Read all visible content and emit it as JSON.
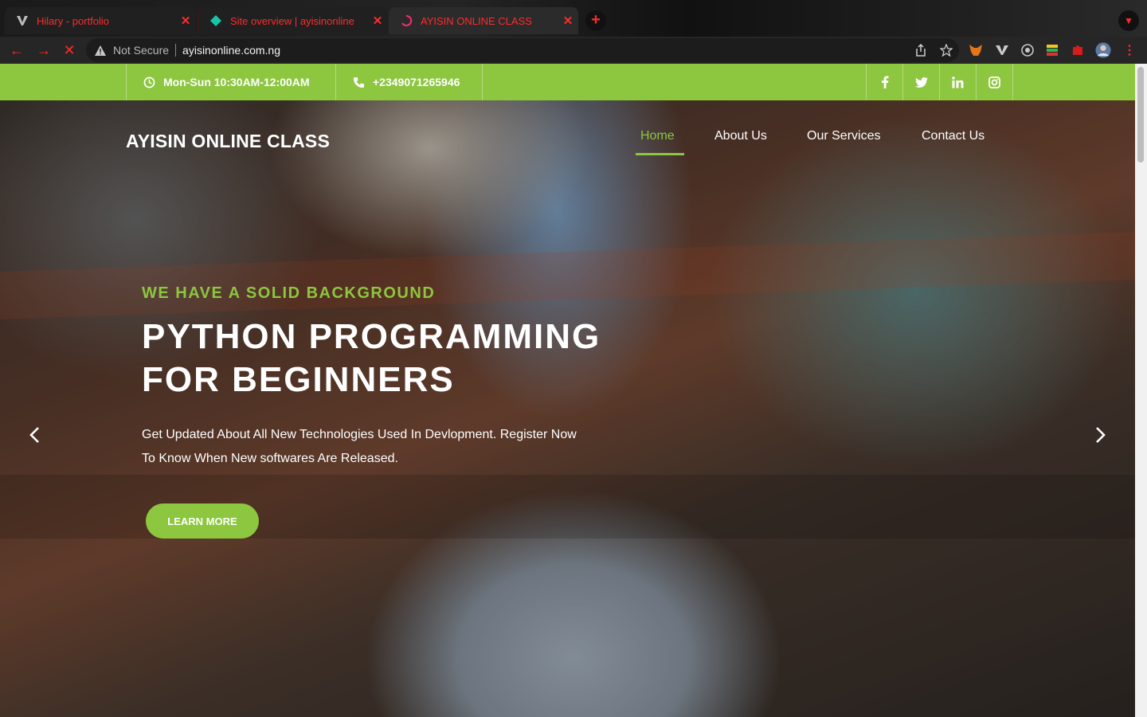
{
  "browser": {
    "tabs": [
      {
        "title": "Hilary - portfolio",
        "favicon": "v-logo-icon"
      },
      {
        "title": "Site overview | ayisinonline",
        "favicon": "diamond-icon"
      },
      {
        "title": "AYISIN ONLINE CLASS",
        "favicon": "loading-spinner-icon"
      }
    ],
    "security_label": "Not Secure",
    "url": "ayisinonline.com.ng",
    "accent": "#ff2b2b"
  },
  "topbar": {
    "hours": "Mon-Sun 10:30AM-12:00AM",
    "phone": "+2349071265946",
    "social": [
      "f",
      "twitter",
      "in",
      "instagram"
    ],
    "color": "#8dc63f"
  },
  "header": {
    "brand": "AYISIN ONLINE CLASS",
    "nav": [
      {
        "label": "Home",
        "active": true
      },
      {
        "label": "About Us"
      },
      {
        "label": "Our Services"
      },
      {
        "label": "Contact Us"
      }
    ]
  },
  "hero": {
    "kicker": "WE HAVE A SOLID BACKGROUND",
    "headline_line1": "PYTHON PROGRAMMING",
    "headline_line2": "FOR BEGINNERS",
    "description_line1": "Get Updated About All New Technologies Used In Devlopment. Register Now",
    "description_line2": "To Know When New softwares Are Released.",
    "cta": "LEARN MORE"
  }
}
